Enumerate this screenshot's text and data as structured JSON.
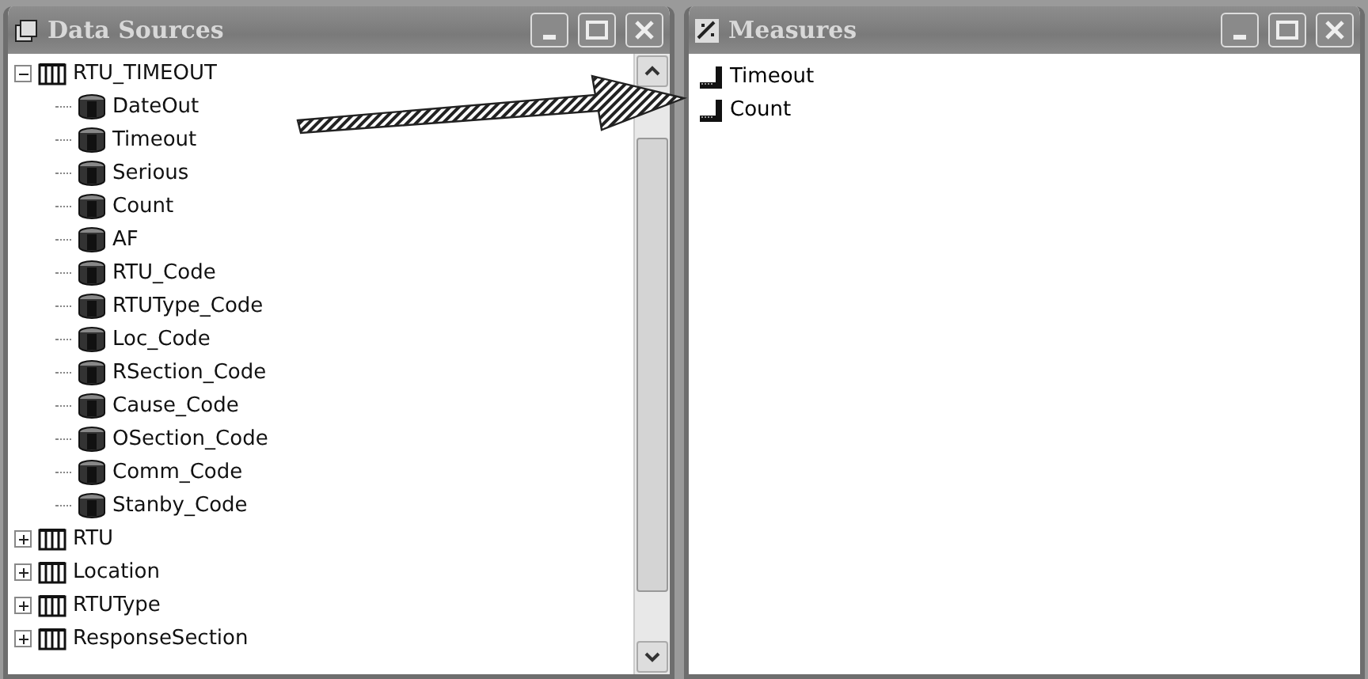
{
  "data_sources": {
    "title": "Data Sources",
    "tree": [
      {
        "label": "RTU_TIMEOUT",
        "kind": "table",
        "expanded": true,
        "children": [
          {
            "label": "DateOut",
            "kind": "column"
          },
          {
            "label": "Timeout",
            "kind": "column"
          },
          {
            "label": "Serious",
            "kind": "column"
          },
          {
            "label": "Count",
            "kind": "column"
          },
          {
            "label": "AF",
            "kind": "column"
          },
          {
            "label": "RTU_Code",
            "kind": "column"
          },
          {
            "label": "RTUType_Code",
            "kind": "column"
          },
          {
            "label": "Loc_Code",
            "kind": "column"
          },
          {
            "label": "RSection_Code",
            "kind": "column"
          },
          {
            "label": "Cause_Code",
            "kind": "column"
          },
          {
            "label": "OSection_Code",
            "kind": "column"
          },
          {
            "label": "Comm_Code",
            "kind": "column"
          },
          {
            "label": "Stanby_Code",
            "kind": "column"
          }
        ]
      },
      {
        "label": "RTU",
        "kind": "table",
        "expanded": false
      },
      {
        "label": "Location",
        "kind": "table",
        "expanded": false
      },
      {
        "label": "RTUType",
        "kind": "table",
        "expanded": false
      },
      {
        "label": "ResponseSection",
        "kind": "table",
        "expanded": false
      }
    ]
  },
  "measures": {
    "title": "Measures",
    "items": [
      {
        "label": "Timeout"
      },
      {
        "label": "Count"
      }
    ]
  }
}
